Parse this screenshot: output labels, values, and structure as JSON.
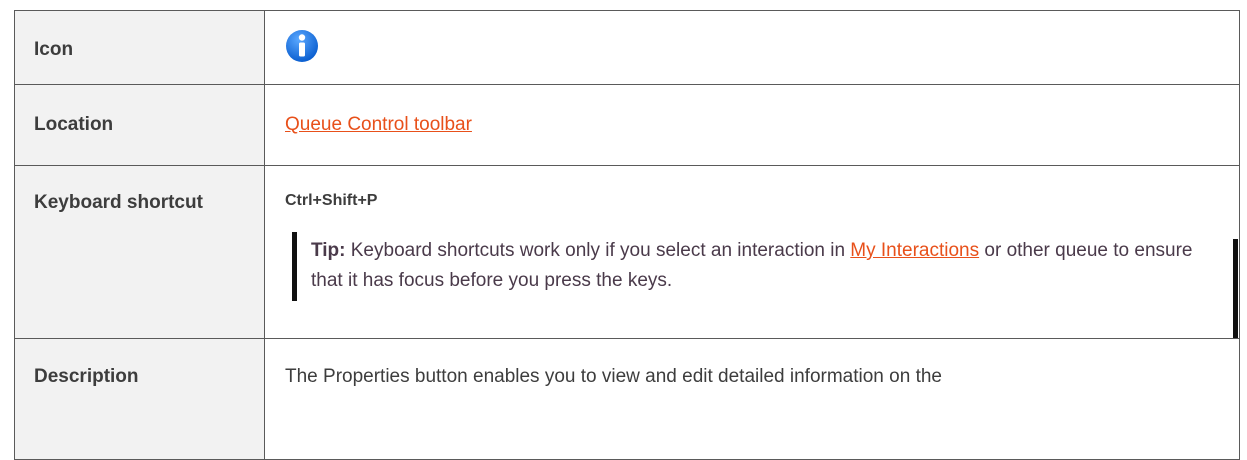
{
  "rows": {
    "icon": {
      "label": "Icon",
      "icon_name": "info-icon",
      "icon_color": "#1a73e8"
    },
    "location": {
      "label": "Location",
      "link_text": "Queue Control toolbar"
    },
    "shortcut": {
      "label": "Keyboard shortcut",
      "keys": "Ctrl+Shift+P",
      "tip": {
        "label": "Tip:",
        "text_before": " Keyboard shortcuts work only if you select an interaction in ",
        "link_text": "My Interactions",
        "text_after": " or other queue to ensure that it has focus before you press the keys."
      }
    },
    "description": {
      "label": "Description",
      "text": "The Properties button enables you to view and edit detailed information on the"
    }
  },
  "colors": {
    "link": "#e8501a",
    "label_background": "#f2f2f2",
    "border": "#5a5a5a",
    "text": "#3d3d3d"
  }
}
